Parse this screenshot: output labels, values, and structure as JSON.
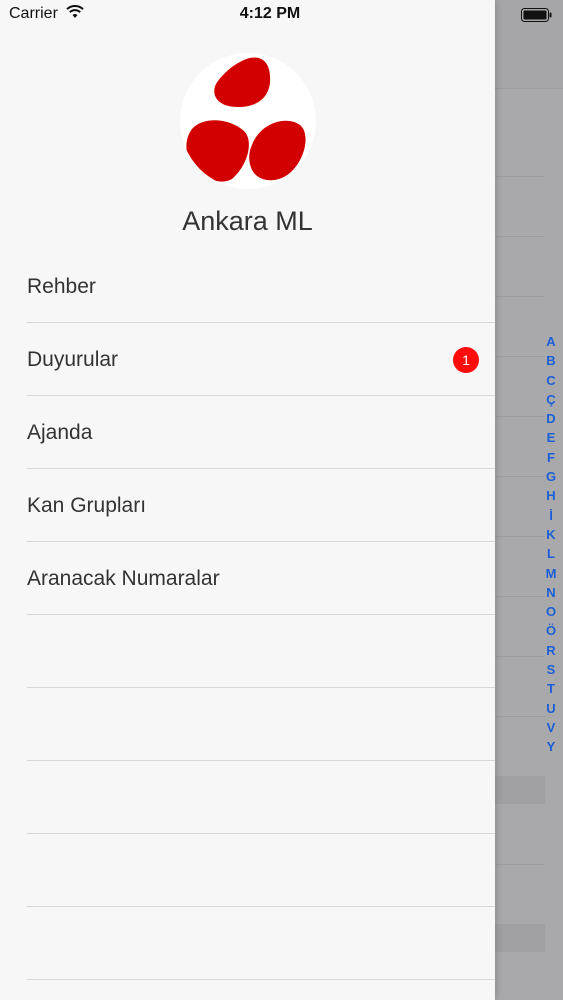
{
  "status_bar": {
    "carrier": "Carrier",
    "time": "4:12 PM",
    "icons": [
      "wifi-icon",
      "battery-icon"
    ]
  },
  "drawer": {
    "org_name": "Ankara ML",
    "logo_icon": "ankara-ml-logo",
    "menu": [
      {
        "label": "Rehber",
        "badge": ""
      },
      {
        "label": "Duyurular",
        "badge": "1"
      },
      {
        "label": "Ajanda",
        "badge": ""
      },
      {
        "label": "Kan Grupları",
        "badge": ""
      },
      {
        "label": "Aranacak Numaralar",
        "badge": ""
      }
    ]
  },
  "index_bar": {
    "letters": [
      "A",
      "B",
      "C",
      "Ç",
      "D",
      "E",
      "F",
      "G",
      "H",
      "İ",
      "K",
      "L",
      "M",
      "N",
      "O",
      "Ö",
      "R",
      "S",
      "T",
      "U",
      "V",
      "Y"
    ]
  },
  "colors": {
    "accent_red": "#d30000",
    "badge_red": "#ff0d0d",
    "index_blue": "#1b5fd6",
    "drawer_bg": "#f7f7f7"
  }
}
